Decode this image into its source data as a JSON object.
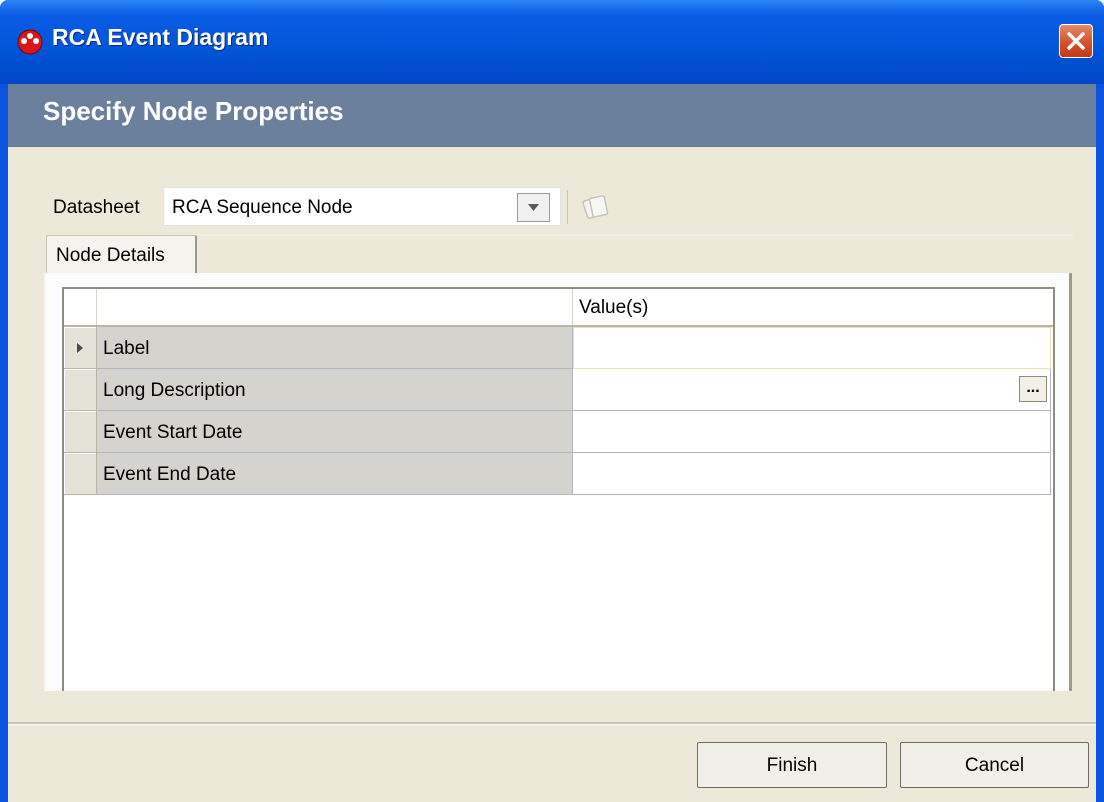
{
  "window": {
    "title": "RCA Event Diagram",
    "close_icon": "close-icon"
  },
  "header": {
    "title": "Specify Node Properties"
  },
  "datasheet": {
    "label": "Datasheet",
    "selected": "RCA Sequence Node"
  },
  "tabs": [
    {
      "label": "Node Details",
      "active": true
    }
  ],
  "grid": {
    "value_header": "Value(s)",
    "rows": [
      {
        "property": "Label",
        "value": "",
        "current": true
      },
      {
        "property": "Long Description",
        "value": "",
        "has_ellipsis": true,
        "ellipsis_label": "..."
      },
      {
        "property": "Event Start Date",
        "value": ""
      },
      {
        "property": "Event End Date",
        "value": ""
      }
    ]
  },
  "buttons": {
    "finish": "Finish",
    "cancel": "Cancel"
  },
  "colors": {
    "titlebar": "#0256d8",
    "header_band": "#6b809c",
    "dialog_bg": "#ece9d8",
    "close_button": "#d4502e"
  }
}
